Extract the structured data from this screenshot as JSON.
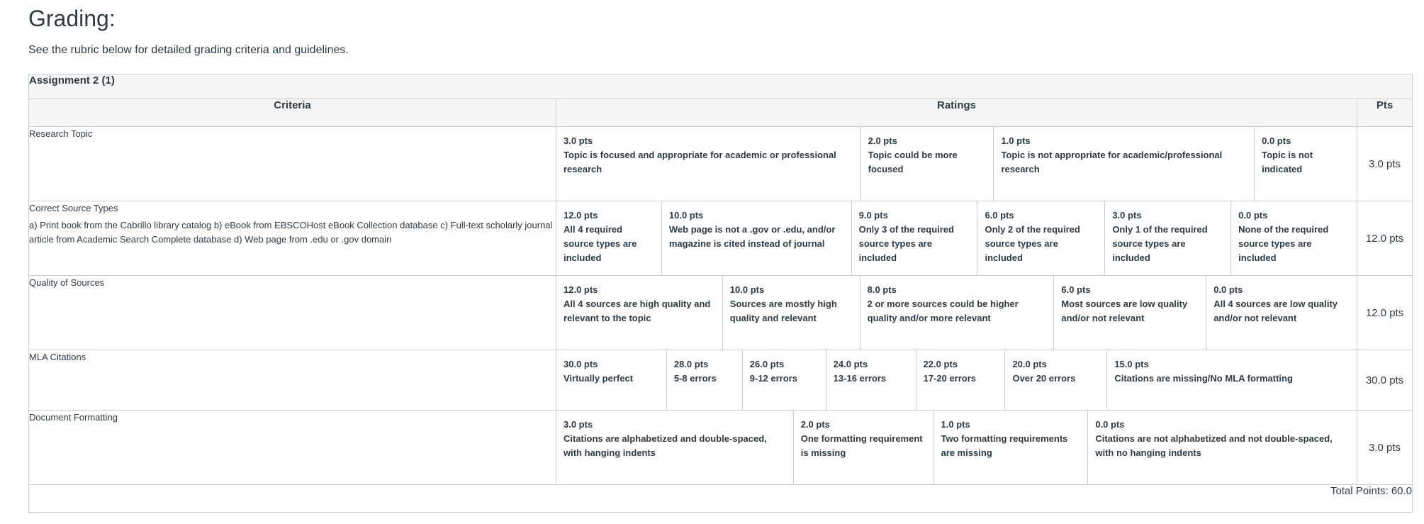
{
  "page": {
    "title": "Grading:",
    "intro": "See the rubric below for detailed grading criteria and guidelines."
  },
  "rubric": {
    "name": "Assignment 2 (1)",
    "headers": {
      "criteria": "Criteria",
      "ratings": "Ratings",
      "pts": "Pts"
    },
    "criteria": [
      {
        "name": "Research Topic",
        "description": "",
        "points": "3.0 pts",
        "ratings": [
          {
            "pts": "3.0 pts",
            "desc": "Topic is focused and appropriate for academic or professional research"
          },
          {
            "pts": "2.0 pts",
            "desc": "Topic could be more focused"
          },
          {
            "pts": "1.0 pts",
            "desc": "Topic is not appropriate for academic/professional research"
          },
          {
            "pts": "0.0 pts",
            "desc": "Topic is not indicated"
          }
        ]
      },
      {
        "name": "Correct Source Types",
        "description": "a) Print book from the Cabrillo library catalog b) eBook from EBSCOHost eBook Collection database c) Full-text scholarly journal article from Academic Search Complete database d) Web page from .edu or .gov domain",
        "points": "12.0 pts",
        "ratings": [
          {
            "pts": "12.0 pts",
            "desc": "All 4 required source types are included"
          },
          {
            "pts": "10.0 pts",
            "desc": "Web page is not a .gov or .edu, and/or magazine is cited instead of journal"
          },
          {
            "pts": "9.0 pts",
            "desc": "Only 3 of the required source types are included"
          },
          {
            "pts": "6.0 pts",
            "desc": "Only 2 of the required source types are included"
          },
          {
            "pts": "3.0 pts",
            "desc": "Only 1 of the required source types are included"
          },
          {
            "pts": "0.0 pts",
            "desc": "None of the required source types are included"
          }
        ]
      },
      {
        "name": "Quality of Sources",
        "description": "",
        "points": "12.0 pts",
        "ratings": [
          {
            "pts": "12.0 pts",
            "desc": "All 4 sources are high quality and relevant to the topic"
          },
          {
            "pts": "10.0 pts",
            "desc": "Sources are mostly high quality and relevant"
          },
          {
            "pts": "8.0 pts",
            "desc": "2 or more sources could be higher quality and/or more relevant"
          },
          {
            "pts": "6.0 pts",
            "desc": "Most sources are low quality and/or not relevant"
          },
          {
            "pts": "0.0 pts",
            "desc": "All 4 sources are low quality and/or not relevant"
          }
        ]
      },
      {
        "name": "MLA Citations",
        "description": "",
        "points": "30.0 pts",
        "ratings": [
          {
            "pts": "30.0 pts",
            "desc": "Virtually perfect"
          },
          {
            "pts": "28.0 pts",
            "desc": "5-8 errors"
          },
          {
            "pts": "26.0 pts",
            "desc": "9-12 errors"
          },
          {
            "pts": "24.0 pts",
            "desc": "13-16 errors"
          },
          {
            "pts": "22.0 pts",
            "desc": "17-20 errors"
          },
          {
            "pts": "20.0 pts",
            "desc": "Over 20 errors"
          },
          {
            "pts": "15.0 pts",
            "desc": "Citations are missing/No MLA formatting"
          }
        ]
      },
      {
        "name": "Document Formatting",
        "description": "",
        "points": "3.0 pts",
        "ratings": [
          {
            "pts": "3.0 pts",
            "desc": "Citations are alphabetized and double-spaced, with hanging indents"
          },
          {
            "pts": "2.0 pts",
            "desc": "One formatting requirement is missing"
          },
          {
            "pts": "1.0 pts",
            "desc": "Two formatting requirements are missing"
          },
          {
            "pts": "0.0 pts",
            "desc": "Citations are not alphabetized and not double-spaced, with no hanging indents"
          }
        ]
      }
    ],
    "total": "Total Points: 60.0"
  }
}
